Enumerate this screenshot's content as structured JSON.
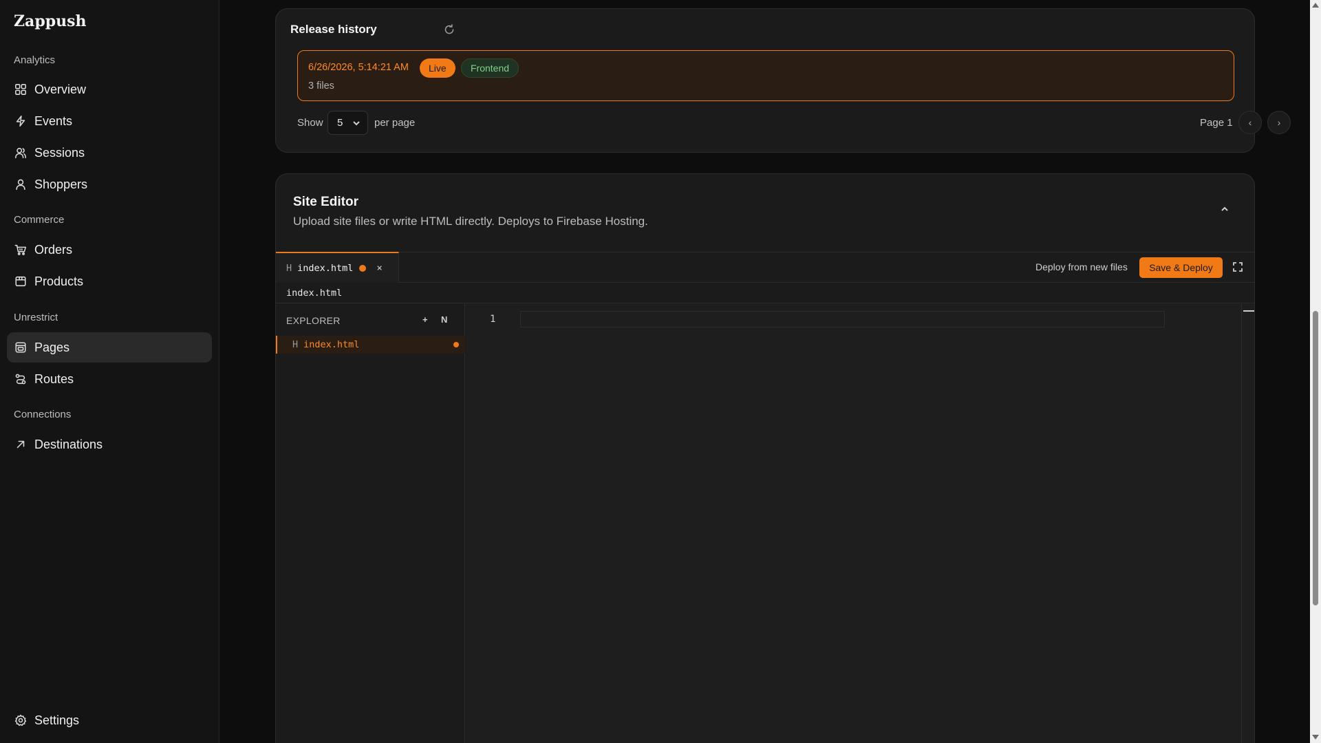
{
  "brand": "Zappush",
  "nav": {
    "sections": {
      "analytics": "Analytics",
      "commerce": "Commerce",
      "unrestrict": "Unrestrict",
      "connections": "Connections"
    },
    "items": {
      "overview": "Overview",
      "events": "Events",
      "sessions": "Sessions",
      "shoppers": "Shoppers",
      "orders": "Orders",
      "products": "Products",
      "pages": "Pages",
      "routes": "Routes",
      "destinations": "Destinations",
      "settings": "Settings"
    },
    "active": "Pages"
  },
  "release_history": {
    "title": "Release history",
    "item": {
      "date": "6/26/2026, 5:14:21 AM",
      "live_badge": "Live",
      "frontend_badge": "Frontend",
      "files": "3 files"
    },
    "pagination": {
      "show_label": "Show",
      "per_page_value": "5",
      "per_page_label": "per page",
      "page_label": "Page 1",
      "prev": "‹",
      "next": "›"
    }
  },
  "site_editor": {
    "title": "Site Editor",
    "subtitle": "Upload site files or write HTML directly. Deploys to Firebase Hosting.",
    "tab": {
      "prefix": "H",
      "name": "index.html",
      "close": "×"
    },
    "deploy_from_new_files": "Deploy from new files",
    "save_deploy": "Save & Deploy",
    "path": "index.html",
    "explorer": {
      "title": "EXPLORER",
      "add": "+",
      "new": "N",
      "file_prefix": "H",
      "file_name": "index.html"
    },
    "line_number": "1"
  },
  "colors": {
    "accent": "#f27a16",
    "accent_text": "#ff8a22",
    "badge_green_text": "#7ed18a"
  },
  "icons": [
    "overview-icon",
    "events-icon",
    "sessions-icon",
    "shoppers-icon",
    "orders-icon",
    "products-icon",
    "pages-icon",
    "routes-icon",
    "destinations-icon",
    "settings-icon",
    "refresh-icon",
    "chevron-down-icon",
    "chevron-up-icon",
    "expand-icon"
  ]
}
